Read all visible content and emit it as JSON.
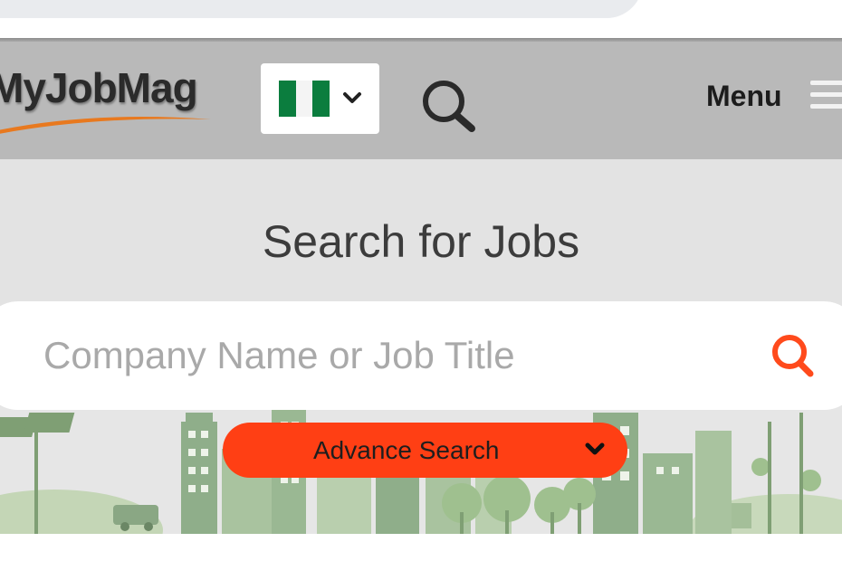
{
  "header": {
    "logo_text": "MyJobMag",
    "menu_label": "Menu",
    "country_flag_icon": "nigeria-flag-icon",
    "search_icon": "search-icon",
    "menu_icon": "hamburger-icon"
  },
  "search": {
    "title": "Search for Jobs",
    "placeholder": "Company Name or Job Title",
    "value": "",
    "advance_label": "Advance Search"
  },
  "colors": {
    "header_bg": "#b9b9b9",
    "section_bg": "#e3e3e3",
    "accent": "#ff3f14",
    "flag_green": "#0b7d3e"
  }
}
